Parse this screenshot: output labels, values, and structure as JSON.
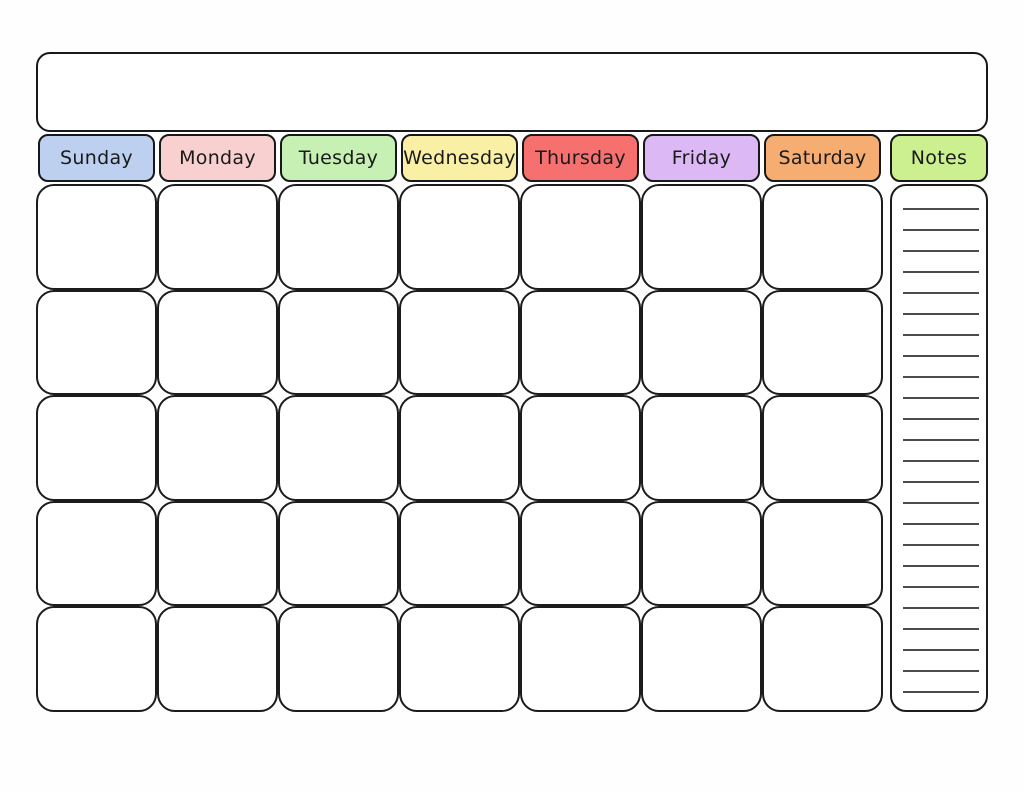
{
  "document": {
    "type": "blank-monthly-calendar-template",
    "title_value": "",
    "title_placeholder": ""
  },
  "header": {
    "days": [
      {
        "label": "Sunday",
        "color": "#bdd0f0"
      },
      {
        "label": "Monday",
        "color": "#f8d0d0"
      },
      {
        "label": "Tuesday",
        "color": "#c7f0b4"
      },
      {
        "label": "Wednesday",
        "color": "#faf0a5"
      },
      {
        "label": "Thursday",
        "color": "#f5706e"
      },
      {
        "label": "Friday",
        "color": "#dcb8f5"
      },
      {
        "label": "Saturday",
        "color": "#f5ad72"
      }
    ],
    "notes": {
      "label": "Notes",
      "color": "#ccf08f"
    }
  },
  "grid": {
    "columns": 7,
    "rows": 5,
    "cells": [
      {
        "row": 1,
        "col": 1,
        "value": ""
      },
      {
        "row": 1,
        "col": 2,
        "value": ""
      },
      {
        "row": 1,
        "col": 3,
        "value": ""
      },
      {
        "row": 1,
        "col": 4,
        "value": ""
      },
      {
        "row": 1,
        "col": 5,
        "value": ""
      },
      {
        "row": 1,
        "col": 6,
        "value": ""
      },
      {
        "row": 1,
        "col": 7,
        "value": ""
      },
      {
        "row": 2,
        "col": 1,
        "value": ""
      },
      {
        "row": 2,
        "col": 2,
        "value": ""
      },
      {
        "row": 2,
        "col": 3,
        "value": ""
      },
      {
        "row": 2,
        "col": 4,
        "value": ""
      },
      {
        "row": 2,
        "col": 5,
        "value": ""
      },
      {
        "row": 2,
        "col": 6,
        "value": ""
      },
      {
        "row": 2,
        "col": 7,
        "value": ""
      },
      {
        "row": 3,
        "col": 1,
        "value": ""
      },
      {
        "row": 3,
        "col": 2,
        "value": ""
      },
      {
        "row": 3,
        "col": 3,
        "value": ""
      },
      {
        "row": 3,
        "col": 4,
        "value": ""
      },
      {
        "row": 3,
        "col": 5,
        "value": ""
      },
      {
        "row": 3,
        "col": 6,
        "value": ""
      },
      {
        "row": 3,
        "col": 7,
        "value": ""
      },
      {
        "row": 4,
        "col": 1,
        "value": ""
      },
      {
        "row": 4,
        "col": 2,
        "value": ""
      },
      {
        "row": 4,
        "col": 3,
        "value": ""
      },
      {
        "row": 4,
        "col": 4,
        "value": ""
      },
      {
        "row": 4,
        "col": 5,
        "value": ""
      },
      {
        "row": 4,
        "col": 6,
        "value": ""
      },
      {
        "row": 4,
        "col": 7,
        "value": ""
      },
      {
        "row": 5,
        "col": 1,
        "value": ""
      },
      {
        "row": 5,
        "col": 2,
        "value": ""
      },
      {
        "row": 5,
        "col": 3,
        "value": ""
      },
      {
        "row": 5,
        "col": 4,
        "value": ""
      },
      {
        "row": 5,
        "col": 5,
        "value": ""
      },
      {
        "row": 5,
        "col": 6,
        "value": ""
      },
      {
        "row": 5,
        "col": 7,
        "value": ""
      }
    ]
  },
  "notes_panel": {
    "line_count": 24,
    "lines": [
      "",
      "",
      "",
      "",
      "",
      "",
      "",
      "",
      "",
      "",
      "",
      "",
      "",
      "",
      "",
      "",
      "",
      "",
      "",
      "",
      "",
      "",
      "",
      ""
    ]
  },
  "colors": {
    "page_background": "#fefefe",
    "border": "#1b1c1e",
    "cell_background": "#ffffff",
    "rule_line": "#4b4b4b"
  }
}
